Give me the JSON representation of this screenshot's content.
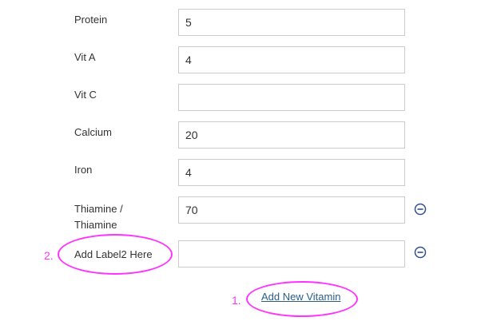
{
  "fields": [
    {
      "label": "Protein",
      "value": "5"
    },
    {
      "label": "Vit A",
      "value": "4"
    },
    {
      "label": "Vit C",
      "value": ""
    },
    {
      "label": "Calcium",
      "value": "20"
    },
    {
      "label": "Iron",
      "value": "4"
    },
    {
      "label_line1": "Thiamine /",
      "label_line2": "Thiamine",
      "value": "70"
    },
    {
      "label": "Add Label2 Here",
      "value": ""
    }
  ],
  "add_link": "Add New Vitamin",
  "annotations": {
    "one": "1.",
    "two": "2."
  },
  "colors": {
    "annotation": "#ff33ff",
    "link": "#2a5d8a",
    "icon": "#2f4f9c"
  },
  "icons": {
    "remove": "minus-circle-icon"
  }
}
